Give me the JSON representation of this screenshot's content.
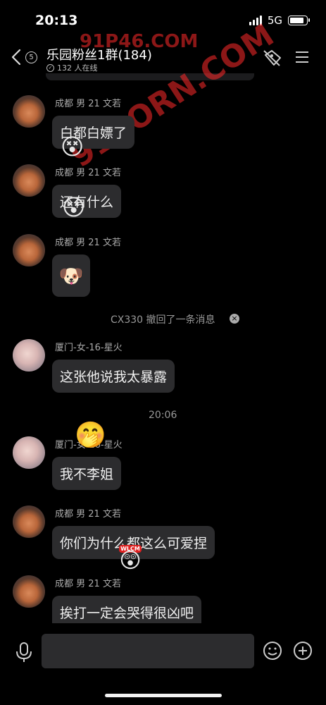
{
  "status_bar": {
    "time": "20:13",
    "network": "5G"
  },
  "header": {
    "back_count": "5",
    "title": "乐园粉丝1群(184)",
    "online": "132 人在线"
  },
  "watermarks": [
    "91P46.COM",
    "91PORN.COM"
  ],
  "messages": [
    {
      "sender": "成都 男 21 文若",
      "text": "白都白嫖了"
    },
    {
      "sender": "成都 男 21 文若",
      "text": "还有什么"
    },
    {
      "sender": "成都 男 21 文若",
      "text": "🐶"
    },
    {
      "system": "CX330 撤回了一条消息"
    },
    {
      "sender": "厦门-女-16-星火",
      "text": "这张他说我太暴露"
    },
    {
      "timestamp": "20:06"
    },
    {
      "sender": "厦门-女-16-星火",
      "text": "我不李姐"
    },
    {
      "sender": "成都 男 21 文若",
      "text": "你们为什么都这么可爱捏"
    },
    {
      "sender": "成都 男 21 文若",
      "text": "挨打一定会哭得很凶吧"
    }
  ],
  "stickers": [
    "😵",
    "😵",
    "🤭",
    "😲"
  ],
  "sticker_labels": {
    "wlcm": "WLCM"
  },
  "icons": {
    "back": "chevron-left-icon",
    "header_right": [
      "tag-icon",
      "menu-icon"
    ],
    "input": [
      "microphone-icon",
      "emoji-icon",
      "add-icon"
    ]
  },
  "colors": {
    "background": "#000000",
    "bubble": "#2c2c2e",
    "watermark": "#ff2a2a"
  }
}
